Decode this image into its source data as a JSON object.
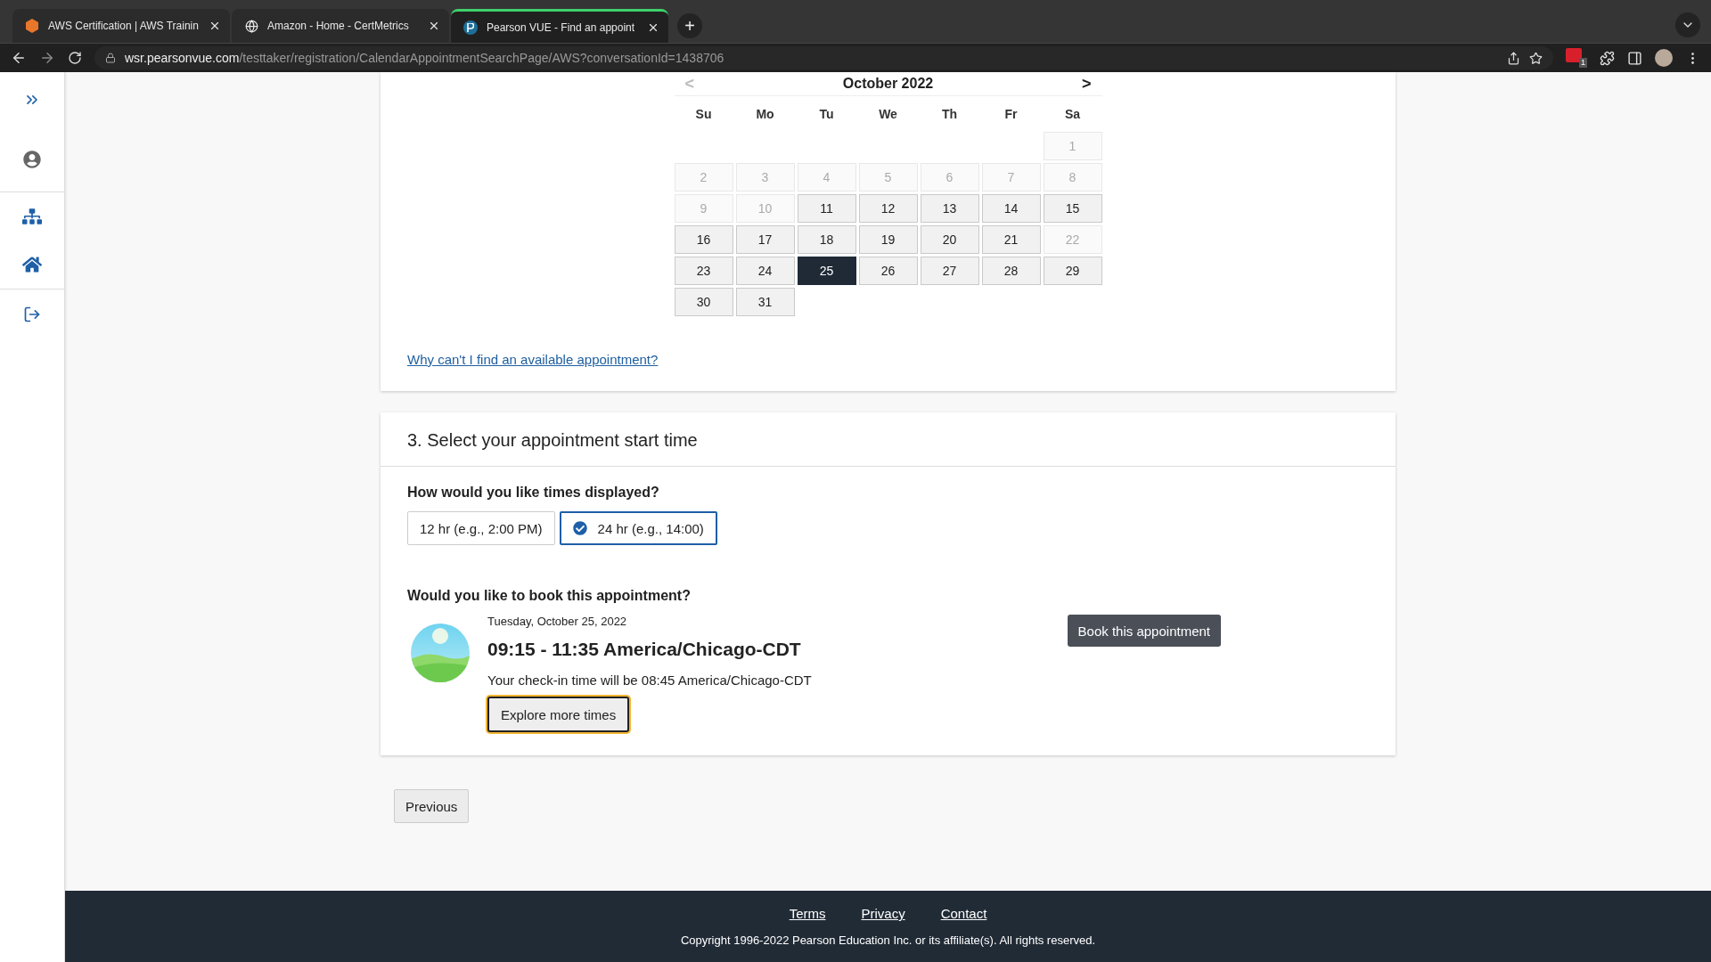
{
  "browser": {
    "tabs": [
      {
        "title": "AWS Certification | AWS Trainin",
        "selected": false
      },
      {
        "title": "Amazon - Home - CertMetrics",
        "selected": false
      },
      {
        "title": "Pearson VUE - Find an appoint",
        "selected": true
      }
    ],
    "new_tab": "+",
    "url_host": "wsr.pearsonvue.com",
    "url_path": "/testtaker/registration/CalendarAppointmentSearchPage/AWS?conversationId=1438706",
    "extension_badge": "1"
  },
  "calendar": {
    "month": "October 2022",
    "prev": {
      "label": "<",
      "disabled": true
    },
    "next": {
      "label": ">",
      "disabled": false
    },
    "weekdays": [
      "Su",
      "Mo",
      "Tu",
      "We",
      "Th",
      "Fr",
      "Sa"
    ],
    "weeks": [
      [
        {
          "label": "1",
          "available": false,
          "selected": false
        }
      ],
      [
        {
          "label": "2",
          "available": false,
          "selected": false
        },
        {
          "label": "3",
          "available": false,
          "selected": false
        },
        {
          "label": "4",
          "available": false,
          "selected": false
        },
        {
          "label": "5",
          "available": false,
          "selected": false
        },
        {
          "label": "6",
          "available": false,
          "selected": false
        },
        {
          "label": "7",
          "available": false,
          "selected": false
        },
        {
          "label": "8",
          "available": false,
          "selected": false
        }
      ],
      [
        {
          "label": "9",
          "available": false,
          "selected": false
        },
        {
          "label": "10",
          "available": false,
          "selected": false
        },
        {
          "label": "11",
          "available": true,
          "selected": false
        },
        {
          "label": "12",
          "available": true,
          "selected": false
        },
        {
          "label": "13",
          "available": true,
          "selected": false
        },
        {
          "label": "14",
          "available": true,
          "selected": false
        },
        {
          "label": "15",
          "available": true,
          "selected": false
        }
      ],
      [
        {
          "label": "16",
          "available": true,
          "selected": false
        },
        {
          "label": "17",
          "available": true,
          "selected": false
        },
        {
          "label": "18",
          "available": true,
          "selected": false
        },
        {
          "label": "19",
          "available": true,
          "selected": false
        },
        {
          "label": "20",
          "available": true,
          "selected": false
        },
        {
          "label": "21",
          "available": true,
          "selected": false
        },
        {
          "label": "22",
          "available": false,
          "selected": false
        }
      ],
      [
        {
          "label": "23",
          "available": true,
          "selected": false
        },
        {
          "label": "24",
          "available": true,
          "selected": false
        },
        {
          "label": "25",
          "available": true,
          "selected": true
        },
        {
          "label": "26",
          "available": true,
          "selected": false
        },
        {
          "label": "27",
          "available": true,
          "selected": false
        },
        {
          "label": "28",
          "available": true,
          "selected": false
        },
        {
          "label": "29",
          "available": true,
          "selected": false
        }
      ],
      [
        {
          "label": "30",
          "available": true,
          "selected": false
        },
        {
          "label": "31",
          "available": true,
          "selected": false
        }
      ]
    ],
    "help_link": "Why can't I find an available appointment?"
  },
  "start_time": {
    "title": "3. Select your appointment start time",
    "format_question": "How would you like times displayed?",
    "formats": [
      {
        "label": "12 hr (e.g., 2:00 PM)",
        "selected": false
      },
      {
        "label": "24 hr (e.g., 14:00)",
        "selected": true
      }
    ],
    "book_question": "Would you like to book this appointment?",
    "date": "Tuesday, October 25, 2022",
    "time": "09:15 - 11:35 America/Chicago-CDT",
    "checkin": "Your check-in time will be 08:45 America/Chicago-CDT",
    "explore_button": "Explore more times",
    "book_button": "Book this appointment"
  },
  "previous_button": "Previous",
  "footer": {
    "links": [
      "Terms",
      "Privacy",
      "Contact"
    ],
    "copyright": "Copyright 1996-2022 Pearson Education Inc. or its affiliate(s). All rights reserved."
  }
}
